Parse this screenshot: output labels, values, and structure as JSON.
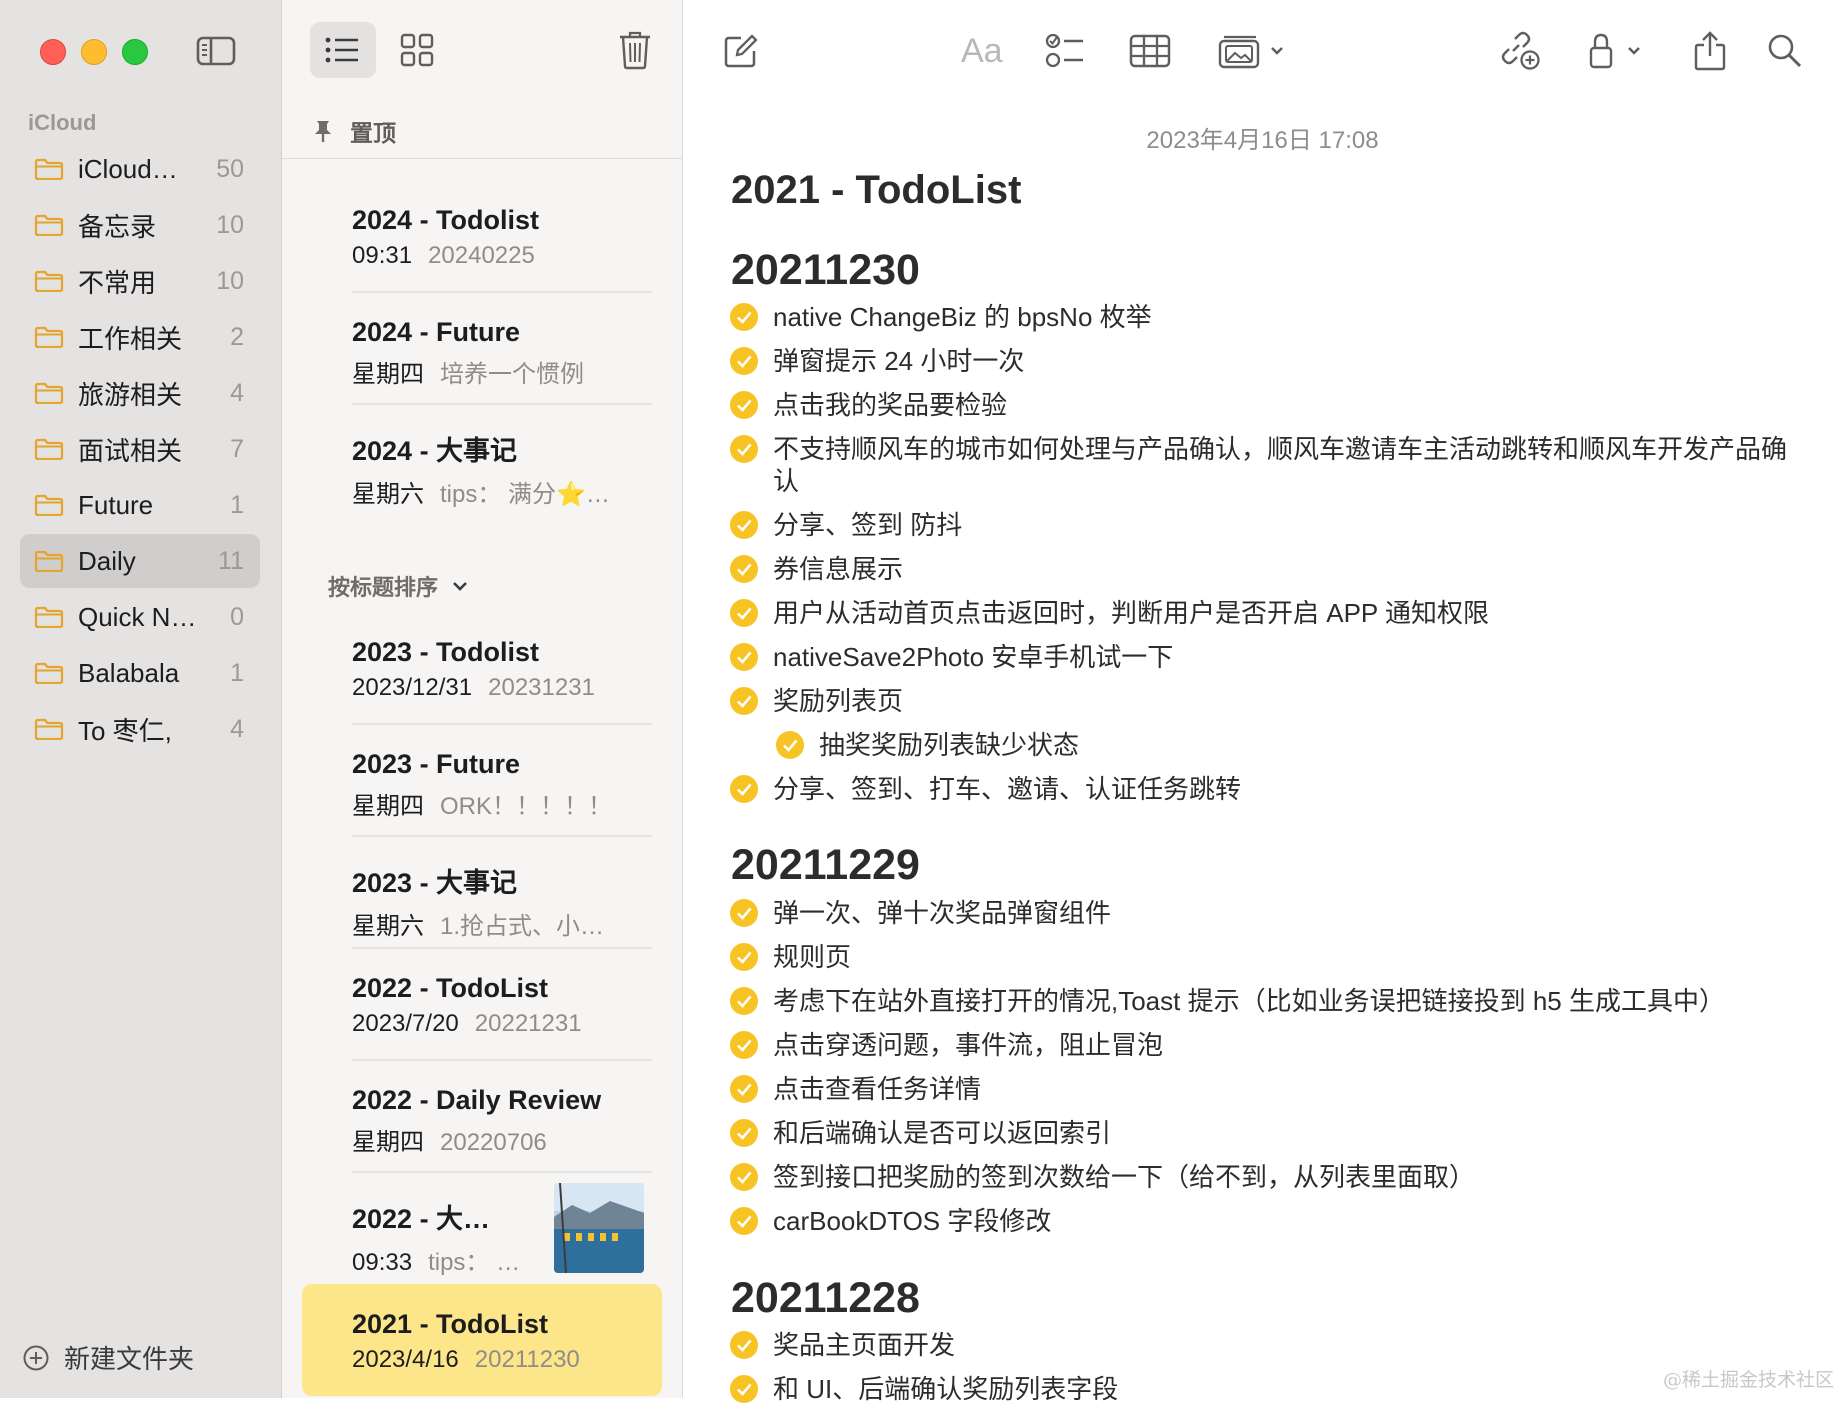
{
  "sidebar": {
    "section": "iCloud",
    "folders": [
      {
        "name": "iCloud…",
        "count": "50"
      },
      {
        "name": "备忘录",
        "count": "10"
      },
      {
        "name": "不常用",
        "count": "10"
      },
      {
        "name": "工作相关",
        "count": "2"
      },
      {
        "name": "旅游相关",
        "count": "4"
      },
      {
        "name": "面试相关",
        "count": "7"
      },
      {
        "name": "Future",
        "count": "1"
      },
      {
        "name": "Daily",
        "count": "11"
      },
      {
        "name": "Quick N…",
        "count": "0"
      },
      {
        "name": "Balabala",
        "count": "1"
      },
      {
        "name": "To 枣仁,",
        "count": "4"
      }
    ],
    "selected_folder": "Daily",
    "new_folder_label": "新建文件夹"
  },
  "notelist": {
    "pinned_label": "置顶",
    "sort_label": "按标题排序",
    "pinned": [
      {
        "title": "2024 - Todolist",
        "date": "09:31",
        "preview": "20240225"
      },
      {
        "title": "2024 - Future",
        "date": "星期四",
        "preview": "培养一个惯例"
      },
      {
        "title": "2024 - 大事记",
        "date": "星期六",
        "preview": "tips： 满分⭐…"
      }
    ],
    "notes": [
      {
        "title": "2023 - Todolist",
        "date": "2023/12/31",
        "preview": "20231231"
      },
      {
        "title": "2023 - Future",
        "date": "星期四",
        "preview": "ORK！！！！！"
      },
      {
        "title": "2023 - 大事记",
        "date": "星期六",
        "preview": "1.抢占式、小…"
      },
      {
        "title": "2022 - TodoList",
        "date": "2023/7/20",
        "preview": "20221231"
      },
      {
        "title": "2022 - Daily Review",
        "date": "星期四",
        "preview": "20220706"
      },
      {
        "title": "2022 - 大…",
        "date": "09:33",
        "preview": "tips：  …"
      },
      {
        "title": "2021 - TodoList",
        "date": "2023/4/16",
        "preview": "20211230"
      }
    ],
    "selected_note": "2021 - TodoList"
  },
  "toolbar": {
    "format_label": "Aa"
  },
  "editor": {
    "date": "2023年4月16日 17:08",
    "title": "2021 - TodoList",
    "sections": [
      {
        "heading": "20211230",
        "items": [
          {
            "text": "native ChangeBiz 的 bpsNo 枚举",
            "checked": true,
            "indent": 0
          },
          {
            "text": "弹窗提示 24 小时一次",
            "checked": true,
            "indent": 0
          },
          {
            "text": "点击我的奖品要检验",
            "checked": true,
            "indent": 0
          },
          {
            "text": "不支持顺风车的城市如何处理与产品确认，顺风车邀请车主活动跳转和顺风车开发产品确认",
            "checked": true,
            "indent": 0
          },
          {
            "text": "分享、签到 防抖",
            "checked": true,
            "indent": 0
          },
          {
            "text": "券信息展示",
            "checked": true,
            "indent": 0
          },
          {
            "text": "用户从活动首页点击返回时，判断用户是否开启 APP 通知权限",
            "checked": true,
            "indent": 0
          },
          {
            "text": "nativeSave2Photo 安卓手机试一下",
            "checked": true,
            "indent": 0
          },
          {
            "text": "奖励列表页",
            "checked": true,
            "indent": 0
          },
          {
            "text": "抽奖奖励列表缺少状态",
            "checked": true,
            "indent": 1
          },
          {
            "text": "分享、签到、打车、邀请、认证任务跳转",
            "checked": true,
            "indent": 0
          }
        ]
      },
      {
        "heading": "20211229",
        "items": [
          {
            "text": "弹一次、弹十次奖品弹窗组件",
            "checked": true,
            "indent": 0
          },
          {
            "text": "规则页",
            "checked": true,
            "indent": 0
          },
          {
            "text": "考虑下在站外直接打开的情况,Toast 提示（比如业务误把链接投到 h5 生成工具中）",
            "checked": true,
            "indent": 0
          },
          {
            "text": "点击穿透问题，事件流，阻止冒泡",
            "checked": true,
            "indent": 0
          },
          {
            "text": "点击查看任务详情",
            "checked": true,
            "indent": 0
          },
          {
            "text": "和后端确认是否可以返回索引",
            "checked": true,
            "indent": 0
          },
          {
            "text": "签到接口把奖励的签到次数给一下（给不到，从列表里面取）",
            "checked": true,
            "indent": 0
          },
          {
            "text": "carBookDTOS 字段修改",
            "checked": true,
            "indent": 0
          }
        ]
      },
      {
        "heading": "20211228",
        "items": [
          {
            "text": "奖品主页面开发",
            "checked": true,
            "indent": 0
          },
          {
            "text": "和 UI、后端确认奖励列表字段",
            "checked": true,
            "indent": 0
          }
        ]
      }
    ]
  },
  "watermark": "@稀土掘金技术社区",
  "colors": {
    "accent": "#f7c325",
    "selected_note_bg": "#fde68a",
    "folder_icon": "#e5a52a"
  }
}
